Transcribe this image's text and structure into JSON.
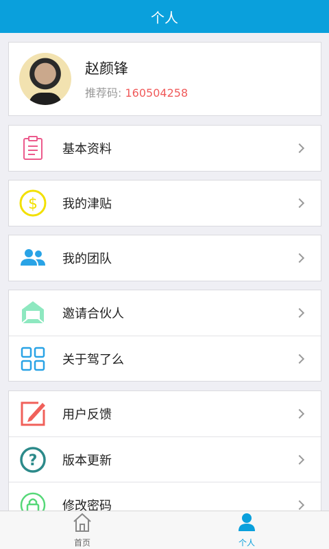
{
  "header": {
    "title": "个人"
  },
  "profile": {
    "name": "赵颜锋",
    "ref_label": "推荐码:",
    "ref_code": "160504258"
  },
  "menu": {
    "basic_info": "基本资料",
    "allowance": "我的津贴",
    "team": "我的团队",
    "invite": "邀请合伙人",
    "about": "关于驾了么",
    "feedback": "用户反馈",
    "version": "版本更新",
    "password": "修改密码"
  },
  "tabbar": {
    "home": "首页",
    "me": "个人"
  },
  "colors": {
    "brand": "#0aa0dc",
    "ref_code": "#f05a5a",
    "icon_pink": "#ec5a8c",
    "icon_yellow": "#f2e000",
    "icon_blue": "#29a3e6",
    "icon_green": "#8ee8c0",
    "icon_red": "#f0605a",
    "icon_teal": "#2c8a8a",
    "icon_lightgreen": "#56d878"
  },
  "icons": [
    "clipboard-icon",
    "dollar-coin-icon",
    "team-icon",
    "envelope-icon",
    "grid-icon",
    "edit-icon",
    "question-icon",
    "lock-icon",
    "home-icon",
    "person-icon"
  ]
}
